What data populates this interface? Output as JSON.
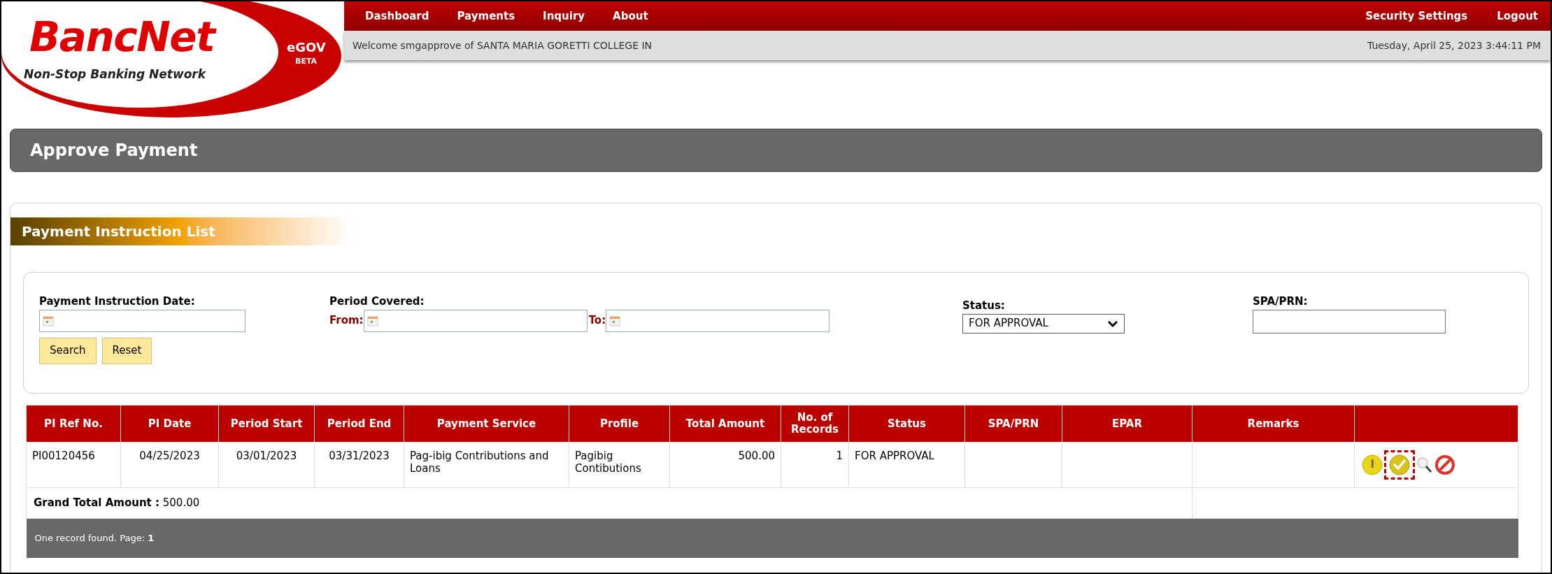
{
  "header": {
    "logo": {
      "name": "BancNet",
      "tagline": "Non-Stop Banking Network",
      "product": "eGOV",
      "badge": "BETA"
    },
    "nav_left": [
      "Dashboard",
      "Payments",
      "Inquiry",
      "About"
    ],
    "nav_right": [
      "Security Settings",
      "Logout"
    ],
    "welcome": "Welcome smgapprove of SANTA MARIA GORETTI COLLEGE IN",
    "datetime": "Tuesday, April 25, 2023 3:44:11 PM"
  },
  "page_title": "Approve Payment",
  "panel": {
    "title": "Payment Instruction List",
    "filters": {
      "pi_date_label": "Payment Instruction Date:",
      "period_label": "Period Covered:",
      "from_label": "From:",
      "to_label": "To:",
      "status_label": "Status:",
      "status_value": "FOR APPROVAL",
      "spa_label": "SPA/PRN:",
      "buttons": [
        "Search",
        "Reset"
      ]
    }
  },
  "table": {
    "columns": [
      "PI Ref No.",
      "PI Date",
      "Period Start",
      "Period End",
      "Payment Service",
      "Profile",
      "Total Amount",
      "No. of Records",
      "Status",
      "SPA/PRN",
      "EPAR",
      "Remarks"
    ],
    "rows": [
      {
        "cells": [
          "PI00120456",
          "04/25/2023",
          "03/01/2023",
          "03/31/2023",
          "Pag-ibig Contributions and Loans",
          "Pagibig Contibutions",
          "500.00",
          "1",
          "FOR APPROVAL",
          "",
          "",
          ""
        ],
        "actions": [
          {
            "kind": "alert",
            "highlighted": false
          },
          {
            "kind": "approve",
            "highlighted": true
          },
          {
            "kind": "view",
            "highlighted": false
          },
          {
            "kind": "reject",
            "highlighted": false
          }
        ]
      }
    ],
    "grand_total": {
      "label": "Grand Total Amount :",
      "value": "500.00"
    },
    "footer": {
      "text": "One record found. Page:",
      "page": "1"
    }
  }
}
